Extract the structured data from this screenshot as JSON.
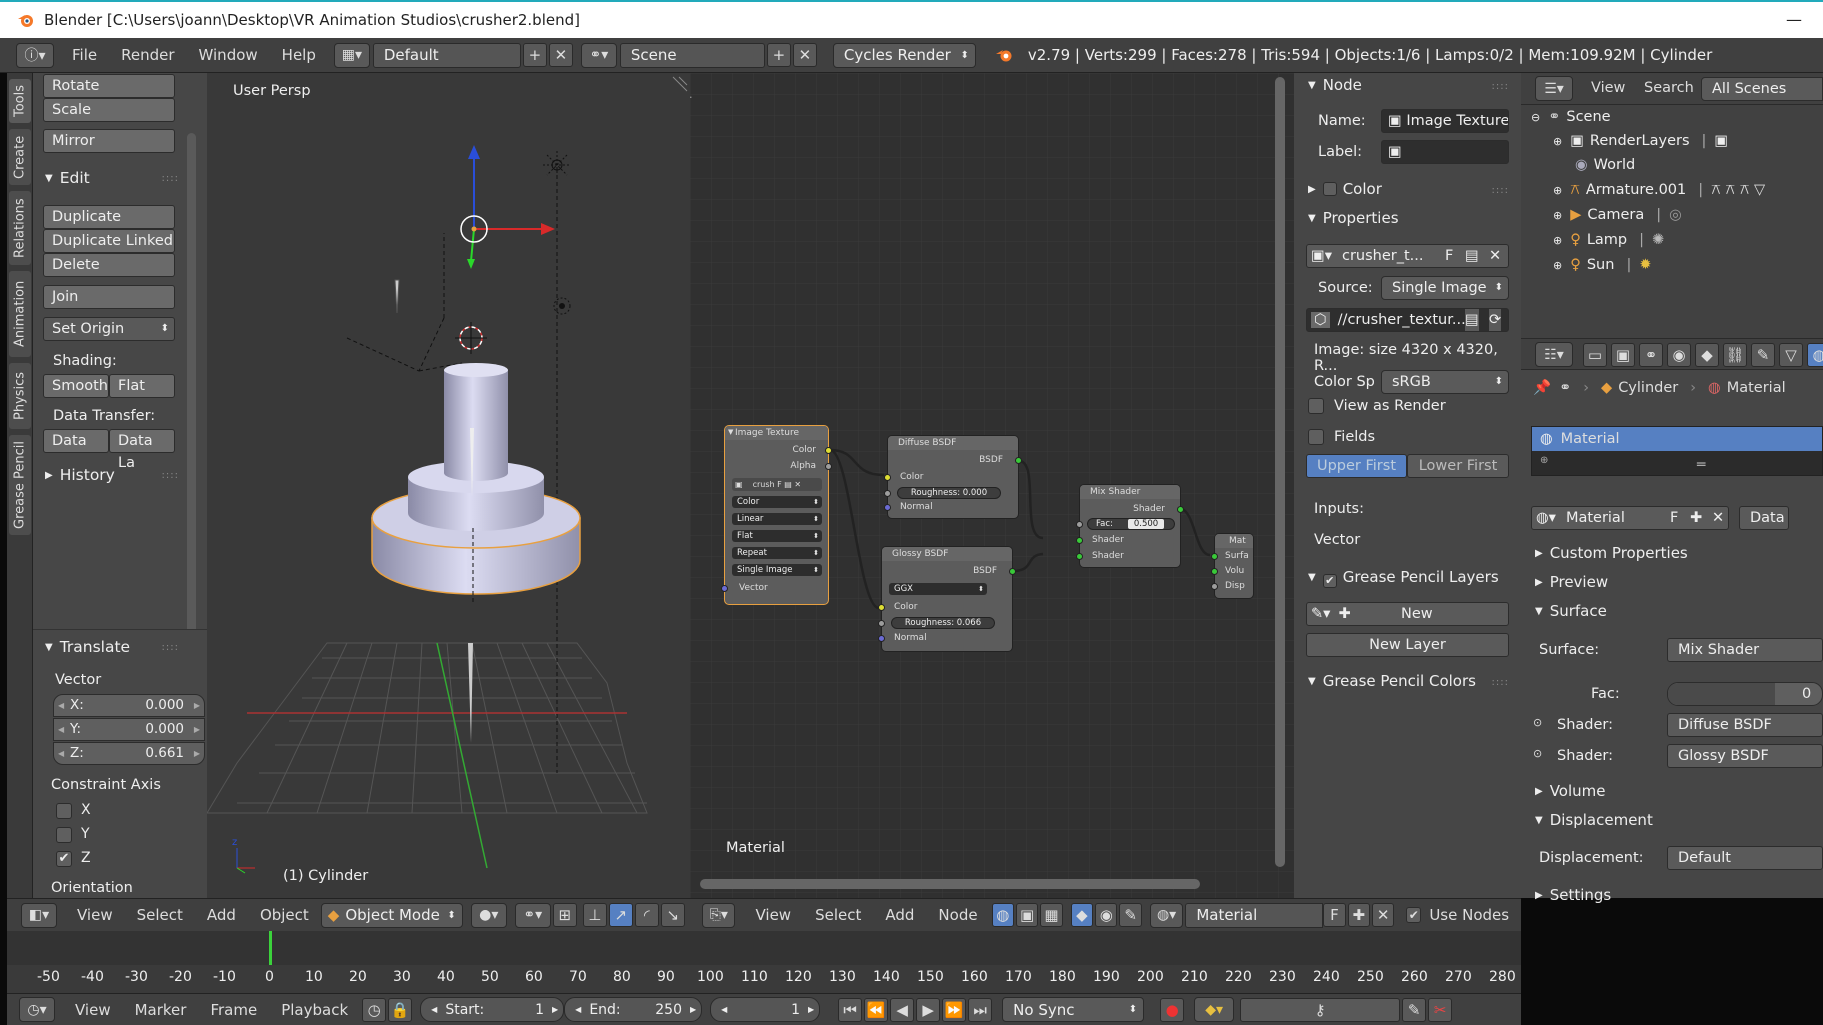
{
  "window": {
    "title": "Blender [C:\\Users\\joann\\Desktop\\VR Animation Studios\\crusher2.blend]",
    "minimize": "—"
  },
  "topbar": {
    "menus": [
      "File",
      "Render",
      "Window",
      "Help"
    ],
    "layout": "Default",
    "scene": "Scene",
    "engine": "Cycles Render",
    "stats": "v2.79 | Verts:299 | Faces:278 | Tris:594 | Objects:1/6 | Lamps:0/2 | Mem:109.92M | Cylinder"
  },
  "toolshelf": {
    "tabs": [
      "Tools",
      "Create",
      "Relations",
      "Animation",
      "Physics",
      "Grease Pencil"
    ],
    "buttons_top": [
      "Rotate",
      "Scale",
      "Mirror"
    ],
    "edit_header": "Edit",
    "edit_buttons": [
      "Duplicate",
      "Duplicate Linked",
      "Delete",
      "Join"
    ],
    "set_origin": "Set Origin",
    "shading_label": "Shading:",
    "smooth": "Smooth",
    "flat": "Flat",
    "data_transfer_label": "Data Transfer:",
    "data": "Data",
    "data_la": "Data La",
    "history_header": "History",
    "translate_header": "Translate",
    "vector_label": "Vector",
    "x_label": "X:",
    "x_value": "0.000",
    "y_label": "Y:",
    "y_value": "0.000",
    "z_label": "Z:",
    "z_value": "0.661",
    "constraint_label": "Constraint Axis",
    "axis_x": "X",
    "axis_y": "Y",
    "axis_z": "Z",
    "orientation_label": "Orientation"
  },
  "viewport": {
    "persp": "User Persp",
    "object": "(1) Cylinder"
  },
  "viewport_header": {
    "menus": [
      "View",
      "Select",
      "Add",
      "Object"
    ],
    "mode": "Object Mode"
  },
  "node_editor": {
    "label": "Material",
    "image_texture": {
      "title": "Image Texture",
      "out_color": "Color",
      "out_alpha": "Alpha",
      "image": "crush",
      "image_f": "F",
      "color": "Color",
      "interp": "Linear",
      "proj": "Flat",
      "ext": "Repeat",
      "source": "Single Image",
      "vector": "Vector"
    },
    "diffuse": {
      "title": "Diffuse BSDF",
      "out": "BSDF",
      "color": "Color",
      "roughness": "Roughness: 0.000",
      "normal": "Normal"
    },
    "glossy": {
      "title": "Glossy BSDF",
      "out": "BSDF",
      "dist": "GGX",
      "color": "Color",
      "roughness": "Roughness: 0.066",
      "normal": "Normal"
    },
    "mix": {
      "title": "Mix Shader",
      "out": "Shader",
      "fac_label": "Fac:",
      "fac_value": "0.500",
      "shader1": "Shader",
      "shader2": "Shader"
    },
    "output": {
      "title": "Mat",
      "surface": "Surfa",
      "volume": "Volu",
      "disp": "Disp"
    }
  },
  "node_header": {
    "menus": [
      "View",
      "Select",
      "Add",
      "Node"
    ],
    "material": "Material",
    "f": "F",
    "use_nodes": "Use Nodes"
  },
  "node_props": {
    "node_header": "Node",
    "name_label": "Name:",
    "name_value": "Image Texture",
    "label_label": "Label:",
    "color_header": "Color",
    "properties_header": "Properties",
    "image_name": "crusher_t...",
    "image_f": "F",
    "source_label": "Source:",
    "source_value": "Single Image",
    "filepath": "//crusher_textur...",
    "image_info": "Image: size 4320 x 4320, R...",
    "colorsp_label": "Color Sp",
    "colorsp_value": "sRGB",
    "view_as_render": "View as Render",
    "fields": "Fields",
    "upper_first": "Upper First",
    "lower_first": "Lower First",
    "inputs_label": "Inputs:",
    "vector_label": "Vector",
    "gp_layers_header": "Grease Pencil Layers",
    "new": "New",
    "new_layer": "New Layer",
    "gp_colors_header": "Grease Pencil Colors"
  },
  "outliner": {
    "menus": [
      "View",
      "Search"
    ],
    "filter": "All Scenes",
    "items": [
      "Scene",
      "RenderLayers",
      "World",
      "Armature.001",
      "Camera",
      "Lamp",
      "Sun"
    ]
  },
  "properties": {
    "breadcrumb_obj": "Cylinder",
    "breadcrumb_mat": "Material",
    "slot": "Material",
    "material_name": "Material",
    "f": "F",
    "data": "Data",
    "custom_props": "Custom Properties",
    "preview": "Preview",
    "surface_header": "Surface",
    "surface_label": "Surface:",
    "surface_value": "Mix Shader",
    "fac_label": "Fac:",
    "fac_value": "0",
    "shader_label": "Shader:",
    "shader1": "Diffuse BSDF",
    "shader2": "Glossy BSDF",
    "volume": "Volume",
    "displacement_header": "Displacement",
    "displacement_label": "Displacement:",
    "displacement_value": "Default",
    "settings": "Settings"
  },
  "timeline": {
    "ticks": [
      "-50",
      "-40",
      "-30",
      "-20",
      "-10",
      "0",
      "10",
      "20",
      "30",
      "40",
      "50",
      "60",
      "70",
      "80",
      "90",
      "100",
      "110",
      "120",
      "130",
      "140",
      "150",
      "160",
      "170",
      "180",
      "190",
      "200",
      "210",
      "220",
      "230",
      "240",
      "250",
      "260",
      "270",
      "280"
    ],
    "menus": [
      "View",
      "Marker",
      "Frame",
      "Playback"
    ],
    "start_label": "Start:",
    "start_value": "1",
    "end_label": "End:",
    "end_value": "250",
    "current": "1",
    "sync": "No Sync"
  },
  "colors": {
    "accent": "#5680c2",
    "selection": "#f0a040",
    "background": "#393939"
  }
}
